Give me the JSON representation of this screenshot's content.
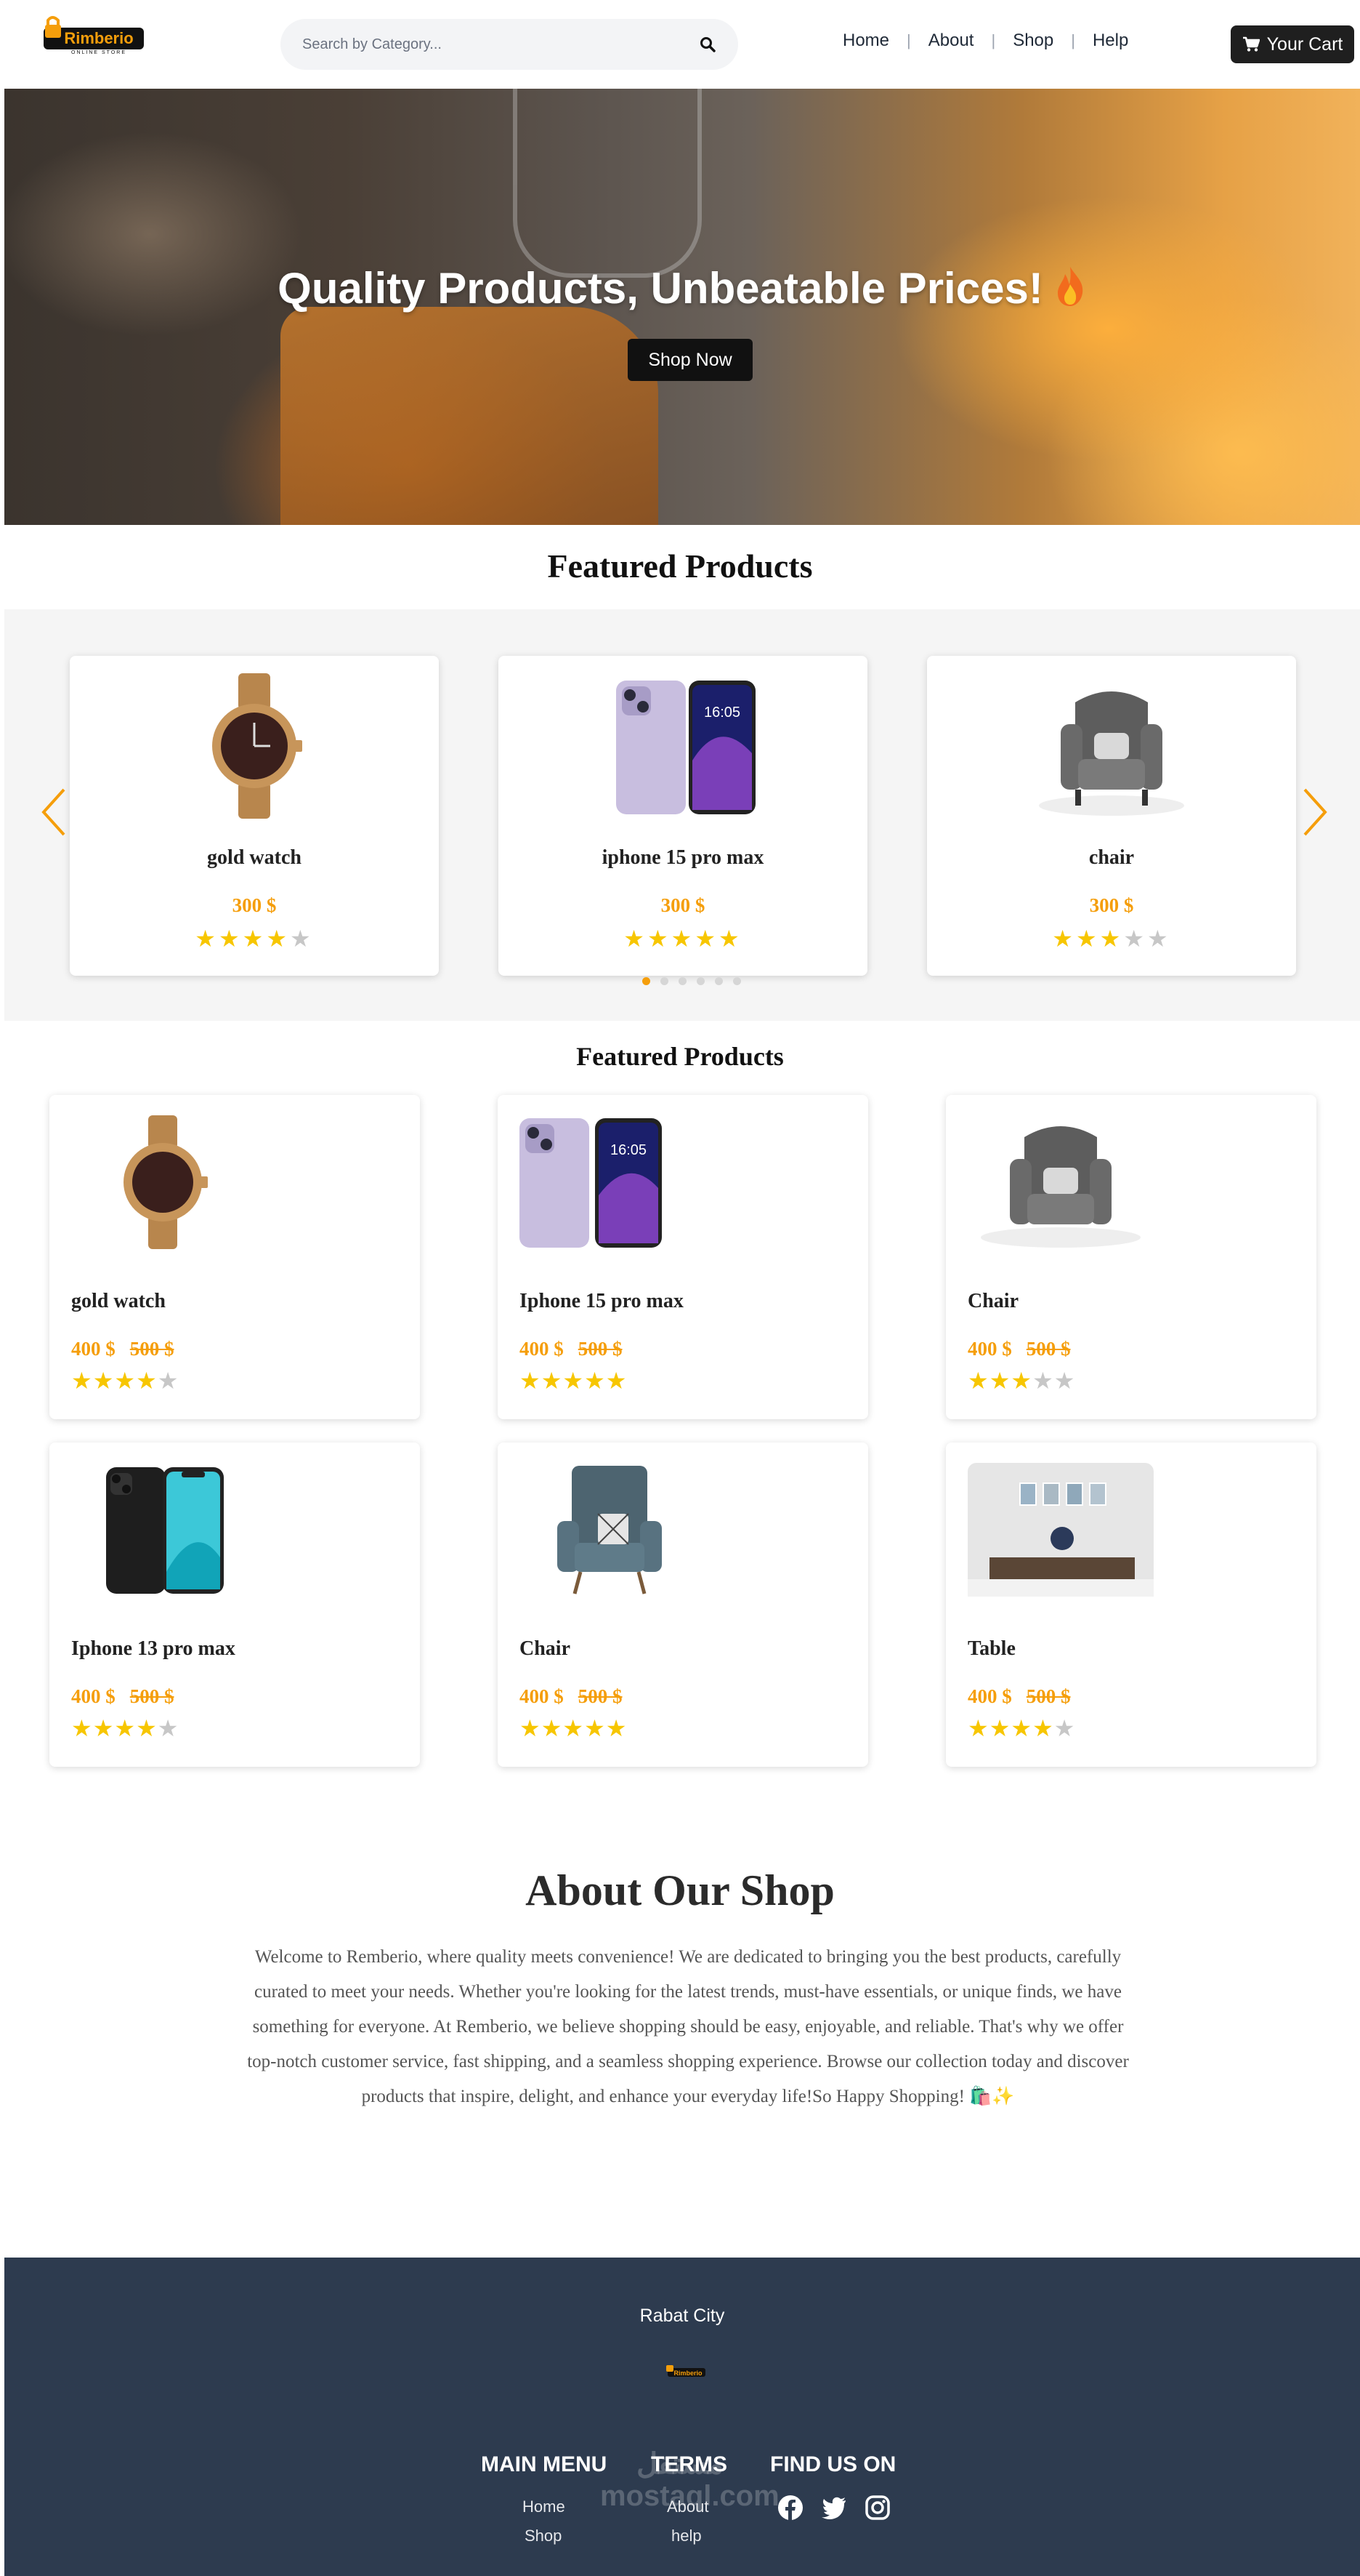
{
  "header": {
    "logo_text": "Rimberio",
    "logo_subtext": "ONLINE STORE",
    "search_placeholder": "Search by Category...",
    "nav": [
      "Home",
      "About",
      "Shop",
      "Help"
    ],
    "cart_label": "Your Cart"
  },
  "hero": {
    "title": "Quality Products, Unbeatable Prices!",
    "button": "Shop Now"
  },
  "featured": {
    "title": "Featured Products",
    "slides": [
      {
        "name": "gold watch",
        "price": "300 $",
        "rating": 4,
        "image": "watch"
      },
      {
        "name": "iphone 15 pro max",
        "price": "300 $",
        "rating": 5,
        "image": "phone-purple"
      },
      {
        "name": "chair",
        "price": "300 $",
        "rating": 3,
        "image": "chair-gray"
      }
    ],
    "dots": 6,
    "active_dot": 0
  },
  "products": {
    "title": "Featured Products",
    "items": [
      {
        "name": "gold watch",
        "price": "400 $",
        "old_price": "500 $",
        "rating": 4,
        "image": "watch"
      },
      {
        "name": "Iphone 15 pro max",
        "price": "400 $",
        "old_price": "500 $",
        "rating": 5,
        "image": "phone-purple"
      },
      {
        "name": "Chair",
        "price": "400 $",
        "old_price": "500 $",
        "rating": 3,
        "image": "chair-gray"
      },
      {
        "name": "Iphone 13 pro max",
        "price": "400 $",
        "old_price": "500 $",
        "rating": 4,
        "image": "phone-black"
      },
      {
        "name": "Chair",
        "price": "400 $",
        "old_price": "500 $",
        "rating": 5,
        "image": "chair-blue"
      },
      {
        "name": "Table",
        "price": "400 $",
        "old_price": "500 $",
        "rating": 4,
        "image": "table-room"
      }
    ]
  },
  "about": {
    "title": "About Our Shop",
    "text": "Welcome to Remberio, where quality meets convenience! We are dedicated to bringing you the best products, carefully curated to meet your needs. Whether you're looking for the latest trends, must-have essentials, or unique finds, we have something for everyone. At Remberio, we believe shopping should be easy, enjoyable, and reliable. That's why we offer top-notch customer service, fast shipping, and a seamless shopping experience. Browse our collection today and discover products that inspire, delight, and enhance your everyday life!So Happy Shopping! 🛍️✨"
  },
  "footer": {
    "city": "Rabat City",
    "logo_text": "Rimberio",
    "main_menu_title": "MAIN MENU",
    "main_menu": [
      "Home",
      "Shop"
    ],
    "terms_title": "TERMS",
    "terms": [
      "About",
      "help"
    ],
    "social_title": "FIND US ON",
    "social": [
      "facebook",
      "twitter",
      "instagram"
    ],
    "watermark": "مستقل mostaql.com"
  },
  "colors": {
    "accent": "#f59e0b",
    "star": "#f7c600",
    "footer_bg": "#2d3b4f",
    "dark_button": "#1f1f1f"
  }
}
